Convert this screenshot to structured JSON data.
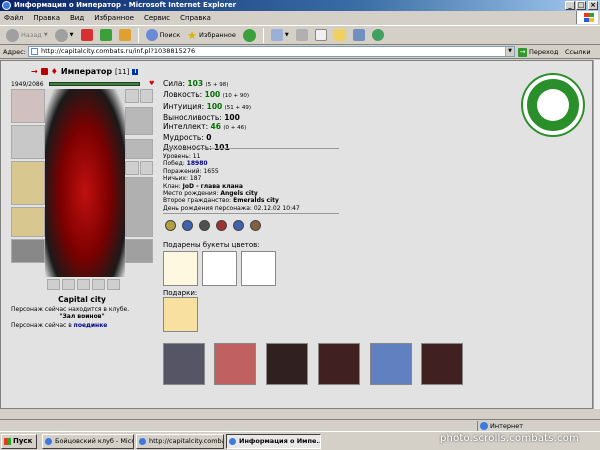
{
  "window": {
    "title": "Информация о Император - Microsoft Internet Explorer",
    "minimize": "_",
    "maximize": "□",
    "close": "×"
  },
  "menu": [
    "Файл",
    "Правка",
    "Вид",
    "Избранное",
    "Сервис",
    "Справка"
  ],
  "toolbar": {
    "back": "Назад",
    "search": "Поиск",
    "favorites": "Избранное",
    "icons": [
      "back-arrow-icon",
      "forward-arrow-icon",
      "stop-icon",
      "refresh-icon",
      "home-icon",
      "search-icon",
      "favorites-star-icon",
      "history-icon",
      "mail-icon",
      "print-icon",
      "edit-icon",
      "folder-icon",
      "messenger-icon",
      "people-icon"
    ]
  },
  "address": {
    "label": "Адрес:",
    "url": "http://capitalcity.combats.ru/inf.pl?1038815276",
    "go": "Переход",
    "links": "Ссылки"
  },
  "character": {
    "name": "Император",
    "level": "[11]",
    "hp": "1949/2086",
    "hp_fraction": 0.93,
    "city": "Capital city",
    "status_line1": "Персонаж сейчас находится в клубе.",
    "status_room": "\"Зал воинов\"",
    "status_line2_prefix": "Персонаж сейчас в",
    "status_line2_link": "поединке"
  },
  "stats": [
    {
      "label": "Сила:",
      "value": "103",
      "detail": "(5 + 98)",
      "green": true
    },
    {
      "label": "Ловкость:",
      "value": "100",
      "detail": "(10 + 90)",
      "green": true
    },
    {
      "label": "Интуиция:",
      "value": "100",
      "detail": "(51 + 49)",
      "green": true
    },
    {
      "label": "Выносливость:",
      "value": "100",
      "detail": "",
      "green": false
    },
    {
      "label": "Интеллект:",
      "value": "46",
      "detail": "(0 + 46)",
      "green": true
    },
    {
      "label": "Мудрость:",
      "value": "0",
      "detail": "",
      "green": false
    },
    {
      "label": "Духовность:",
      "value": "101",
      "detail": "",
      "green": false
    }
  ],
  "info": {
    "level_label": "Уровень:",
    "level_value": "11",
    "wins_label": "Побед:",
    "wins_value": "18980",
    "losses_label": "Поражений:",
    "losses_value": "1655",
    "draws_label": "Ничьих:",
    "draws_value": "187",
    "clan_label": "Клан:",
    "clan_value": "JoD - глава клана",
    "birthplace_label": "Место рождения:",
    "birthplace_value": "Angels city",
    "citizenship_label": "Второе гражданство:",
    "citizenship_value": "Emeralds city",
    "birthday_label": "День рождения персонажа:",
    "birthday_value": "02.12.02 10:47"
  },
  "bouquets_label": "Подарены букеты цветов:",
  "gifts_label": "Подарки:",
  "statusbar": {
    "zone": "Интернет"
  },
  "taskbar": {
    "start": "Пуск",
    "items": [
      "Бойцовский клуб - Micr...",
      "http://capitalcity.combat...",
      "Информация о Импе..."
    ]
  },
  "watermark": "photo.scrolls.combats.com",
  "colors": {
    "accent_green": "#007000",
    "link_blue": "#00008b",
    "hp_green": "#2e8b2e",
    "title_blue": "#0a246a"
  }
}
